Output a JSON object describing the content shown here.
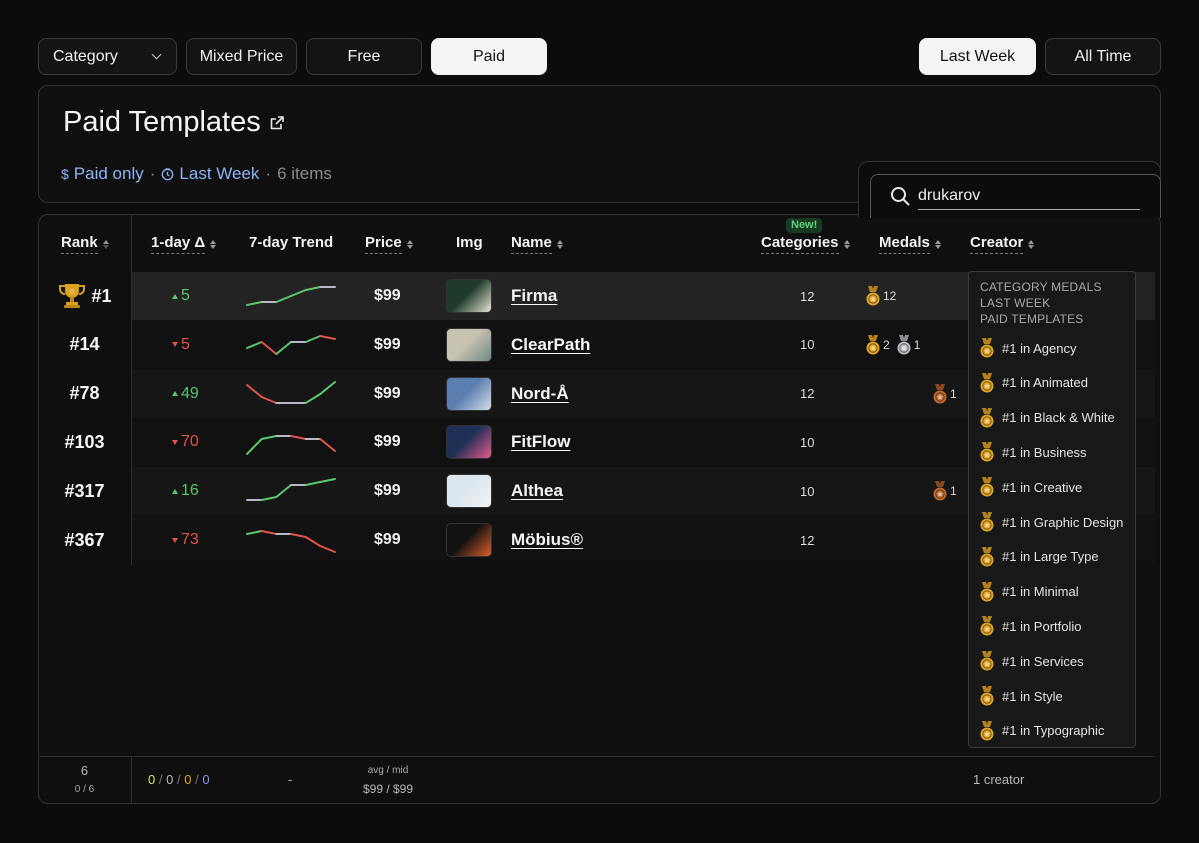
{
  "filters": {
    "category_label": "Category",
    "price_options": [
      "Mixed Price",
      "Free",
      "Paid"
    ],
    "price_active": "Paid",
    "period_options": [
      "Last Week",
      "All Time"
    ],
    "period_active": "Last Week"
  },
  "header": {
    "title": "Paid Templates",
    "price_filter": "Paid only",
    "period_filter": "Last Week",
    "separator": "·",
    "item_count": "6 items"
  },
  "search": {
    "value": "drukarov"
  },
  "columns": {
    "rank": "Rank",
    "delta": "1-day Δ",
    "trend": "7-day Trend",
    "price": "Price",
    "img": "Img",
    "name": "Name",
    "categories": "Categories",
    "categories_badge": "New!",
    "medals": "Medals",
    "creator": "Creator"
  },
  "rows": [
    {
      "rank": "#1",
      "trophy": true,
      "delta": "5",
      "delta_dir": "up",
      "trend": [
        2,
        3,
        3,
        5,
        7,
        8,
        8
      ],
      "price": "$99",
      "name": "Firma",
      "categories": "12",
      "medals": [
        {
          "type": "gold",
          "count": "12"
        }
      ],
      "thumb": [
        "#1e3a2a",
        "#e8e4d6"
      ]
    },
    {
      "rank": "#14",
      "trophy": false,
      "delta": "5",
      "delta_dir": "down",
      "trend": [
        4,
        6,
        2,
        6,
        6,
        8,
        7
      ],
      "price": "$99",
      "name": "ClearPath",
      "categories": "10",
      "medals": [
        {
          "type": "gold",
          "count": "2"
        },
        {
          "type": "silver",
          "count": "1"
        }
      ],
      "thumb": [
        "#c8c2b0",
        "#6e8a84"
      ]
    },
    {
      "rank": "#78",
      "trophy": false,
      "delta": "49",
      "delta_dir": "up",
      "trend": [
        8,
        4,
        2,
        2,
        2,
        5,
        9
      ],
      "price": "$99",
      "name": "Nord-Å",
      "categories": "12",
      "medals": [
        {
          "type": "bronze",
          "count": "1"
        }
      ],
      "thumb": [
        "#5b7eb0",
        "#d4dde8"
      ]
    },
    {
      "rank": "#103",
      "trophy": false,
      "delta": "70",
      "delta_dir": "down",
      "trend": [
        1,
        6,
        7,
        7,
        6,
        6,
        2
      ],
      "price": "$99",
      "name": "FitFlow",
      "categories": "10",
      "medals": [],
      "thumb": [
        "#1f2f55",
        "#e45a8c"
      ]
    },
    {
      "rank": "#317",
      "trophy": false,
      "delta": "16",
      "delta_dir": "up",
      "trend": [
        2,
        2,
        3,
        7,
        7,
        8,
        9
      ],
      "price": "$99",
      "name": "Althea",
      "categories": "10",
      "medals": [
        {
          "type": "bronze",
          "count": "1"
        }
      ],
      "thumb": [
        "#dce6ee",
        "#f4f4f4"
      ]
    },
    {
      "rank": "#367",
      "trophy": false,
      "delta": "73",
      "delta_dir": "down",
      "trend": [
        7,
        8,
        7,
        7,
        6,
        3,
        1
      ],
      "price": "$99",
      "name": "Möbius®",
      "categories": "12",
      "medals": [],
      "thumb": [
        "#111111",
        "#e0602a"
      ]
    }
  ],
  "medals_popup": {
    "heading": [
      "CATEGORY MEDALS",
      "LAST WEEK",
      "PAID TEMPLATES"
    ],
    "items": [
      "#1 in Agency",
      "#1 in Animated",
      "#1 in Black & White",
      "#1 in Business",
      "#1 in Creative",
      "#1 in Graphic Design",
      "#1 in Large Type",
      "#1 in Minimal",
      "#1 in Portfolio",
      "#1 in Services",
      "#1 in Style",
      "#1 in Typographic"
    ]
  },
  "footer": {
    "count": "6",
    "count_sub": "0 / 6",
    "delta_values": [
      "0",
      "0",
      "0",
      "0"
    ],
    "delta_sep": "/",
    "trend": "-",
    "price_label": "avg / mid",
    "price_values": "$99 / $99",
    "creators": "1 creator"
  },
  "colors": {
    "up": "#5ac76e",
    "down": "#e0534a",
    "flat": "#b8b8c8",
    "gold": "#e0a526",
    "silver": "#b9bcc2",
    "bronze": "#c26b2e",
    "accent_blue": "#8fb4f5",
    "footer_delta": [
      "#d8e36a",
      "#b8b8b8",
      "#e0a526",
      "#8a8ff0"
    ]
  }
}
